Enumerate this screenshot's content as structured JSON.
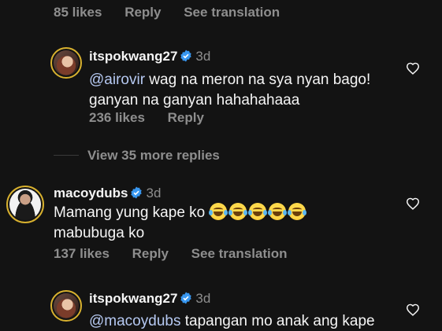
{
  "top_meta": {
    "likes": "85 likes",
    "reply": "Reply",
    "see_translation": "See translation"
  },
  "reply1": {
    "username": "itspokwang27",
    "time": "3d",
    "mention": "@airovir",
    "text_rest": " wag na meron na sya nyan bago!",
    "line2": "ganyan na ganyan hahahahaaa",
    "likes": "236 likes",
    "reply": "Reply"
  },
  "view_more": {
    "label": "View 35 more replies"
  },
  "comment2": {
    "username": "macoydubs",
    "time": "3d",
    "line1": "Mamang yung kape ko ",
    "emoji_count": 5,
    "line2": "mabubuga ko",
    "likes": "137 likes",
    "reply": "Reply",
    "see_translation": "See translation"
  },
  "reply2": {
    "username": "itspokwang27",
    "time": "3d",
    "mention": "@macoydubs",
    "text_rest": " tapangan mo anak ang kape"
  },
  "colors": {
    "background": "#131313",
    "mention": "#b6c9f2",
    "verified": "#3897f0",
    "avatar_ring": "#d8b12f"
  },
  "icons": [
    "verified-badge-icon",
    "heart-icon",
    "face-with-tears-of-joy-emoji"
  ]
}
